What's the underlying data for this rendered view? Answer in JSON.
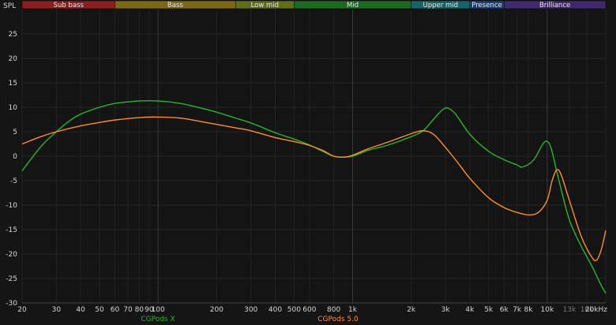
{
  "chart_data": {
    "type": "line",
    "ylabel": "SPL",
    "x_scale": "log",
    "xlim": [
      20,
      20000
    ],
    "ylim": [
      -30,
      30
    ],
    "grid": true,
    "bands": [
      {
        "name": "Sub bass",
        "from": 20,
        "to": 60,
        "color": "#8a1f1f"
      },
      {
        "name": "Bass",
        "from": 60,
        "to": 250,
        "color": "#7c6715"
      },
      {
        "name": "Low mid",
        "from": 250,
        "to": 500,
        "color": "#5f6e1a"
      },
      {
        "name": "Mid",
        "from": 500,
        "to": 2000,
        "color": "#1d6a22"
      },
      {
        "name": "Upper mid",
        "from": 2000,
        "to": 4000,
        "color": "#176468"
      },
      {
        "name": "Presence",
        "from": 4000,
        "to": 6000,
        "color": "#1f3f77"
      },
      {
        "name": "Brilliance",
        "from": 6000,
        "to": 20000,
        "color": "#3f2a6d"
      }
    ],
    "y_ticks": [
      25,
      20,
      15,
      10,
      5,
      0,
      -5,
      -10,
      -15,
      -20,
      -25,
      -30
    ],
    "x_ticks": [
      {
        "value": 20,
        "label": "20",
        "dim": false
      },
      {
        "value": 30,
        "label": "30",
        "dim": false
      },
      {
        "value": 40,
        "label": "40",
        "dim": false
      },
      {
        "value": 50,
        "label": "50",
        "dim": false
      },
      {
        "value": 60,
        "label": "60",
        "dim": false
      },
      {
        "value": 70,
        "label": "70",
        "dim": false
      },
      {
        "value": 80,
        "label": "80",
        "dim": false
      },
      {
        "value": 90,
        "label": "90",
        "dim": false
      },
      {
        "value": 100,
        "label": "100",
        "dim": false
      },
      {
        "value": 200,
        "label": "200",
        "dim": false
      },
      {
        "value": 300,
        "label": "300",
        "dim": false
      },
      {
        "value": 400,
        "label": "400",
        "dim": false
      },
      {
        "value": 500,
        "label": "500",
        "dim": false
      },
      {
        "value": 600,
        "label": "600",
        "dim": false
      },
      {
        "value": 800,
        "label": "800",
        "dim": false
      },
      {
        "value": 1000,
        "label": "1k",
        "dim": false
      },
      {
        "value": 2000,
        "label": "2k",
        "dim": false
      },
      {
        "value": 3000,
        "label": "3k",
        "dim": false
      },
      {
        "value": 4000,
        "label": "4k",
        "dim": false
      },
      {
        "value": 5000,
        "label": "5k",
        "dim": false
      },
      {
        "value": 6000,
        "label": "6k",
        "dim": false
      },
      {
        "value": 7000,
        "label": "7k",
        "dim": false
      },
      {
        "value": 8000,
        "label": "8k",
        "dim": false
      },
      {
        "value": 10000,
        "label": "10k",
        "dim": false
      },
      {
        "value": 13000,
        "label": "13k",
        "dim": true
      },
      {
        "value": 16000,
        "label": "16k",
        "dim": true
      },
      {
        "value": 20000,
        "label": "20kHz",
        "dim": false
      }
    ],
    "series": [
      {
        "name": "CGPods X",
        "color": "#2ab52a",
        "points": [
          [
            20,
            -3
          ],
          [
            25,
            2
          ],
          [
            30,
            5
          ],
          [
            35,
            7.2
          ],
          [
            40,
            8.6
          ],
          [
            50,
            10
          ],
          [
            60,
            10.8
          ],
          [
            70,
            11.1
          ],
          [
            80,
            11.3
          ],
          [
            100,
            11.3
          ],
          [
            130,
            10.8
          ],
          [
            160,
            10
          ],
          [
            200,
            9
          ],
          [
            250,
            7.8
          ],
          [
            300,
            6.8
          ],
          [
            400,
            4.8
          ],
          [
            500,
            3.5
          ],
          [
            600,
            2.3
          ],
          [
            700,
            1
          ],
          [
            800,
            0
          ],
          [
            900,
            -0.2
          ],
          [
            1000,
            0
          ],
          [
            1200,
            1.2
          ],
          [
            1500,
            2.2
          ],
          [
            2000,
            4
          ],
          [
            2300,
            5.2
          ],
          [
            2600,
            7.5
          ],
          [
            2900,
            9.5
          ],
          [
            3100,
            9.8
          ],
          [
            3400,
            8.5
          ],
          [
            4000,
            4.5
          ],
          [
            5000,
            1
          ],
          [
            6000,
            -0.7
          ],
          [
            7000,
            -1.8
          ],
          [
            7500,
            -2.2
          ],
          [
            8500,
            -0.8
          ],
          [
            9500,
            2.5
          ],
          [
            10000,
            3
          ],
          [
            10500,
            1.5
          ],
          [
            11500,
            -5
          ],
          [
            13000,
            -13
          ],
          [
            15000,
            -18.5
          ],
          [
            17000,
            -22.5
          ],
          [
            19000,
            -26.5
          ],
          [
            20000,
            -28
          ]
        ]
      },
      {
        "name": "CGPods 5.0",
        "color": "#ff8d30",
        "points": [
          [
            20,
            2.5
          ],
          [
            25,
            4
          ],
          [
            30,
            5
          ],
          [
            40,
            6.2
          ],
          [
            50,
            6.9
          ],
          [
            60,
            7.4
          ],
          [
            80,
            7.9
          ],
          [
            100,
            8
          ],
          [
            130,
            7.8
          ],
          [
            160,
            7.2
          ],
          [
            200,
            6.5
          ],
          [
            250,
            5.8
          ],
          [
            300,
            5.2
          ],
          [
            400,
            3.8
          ],
          [
            500,
            3
          ],
          [
            600,
            2.2
          ],
          [
            700,
            1.2
          ],
          [
            800,
            0
          ],
          [
            900,
            -0.2
          ],
          [
            1000,
            0.2
          ],
          [
            1200,
            1.5
          ],
          [
            1500,
            2.8
          ],
          [
            2000,
            4.6
          ],
          [
            2300,
            5.2
          ],
          [
            2600,
            4.5
          ],
          [
            3000,
            1.8
          ],
          [
            3500,
            -1.5
          ],
          [
            4000,
            -4.5
          ],
          [
            5000,
            -8.5
          ],
          [
            6000,
            -10.5
          ],
          [
            7000,
            -11.5
          ],
          [
            8000,
            -12
          ],
          [
            9000,
            -11.5
          ],
          [
            10000,
            -9
          ],
          [
            10600,
            -5
          ],
          [
            11200,
            -2.8
          ],
          [
            11800,
            -3.8
          ],
          [
            13000,
            -9
          ],
          [
            15000,
            -16.5
          ],
          [
            17000,
            -20.7
          ],
          [
            18000,
            -21.2
          ],
          [
            19000,
            -19
          ],
          [
            20000,
            -15.2
          ]
        ]
      }
    ]
  }
}
